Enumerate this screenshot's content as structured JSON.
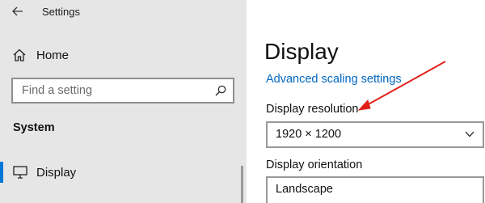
{
  "window": {
    "title": "Settings"
  },
  "sidebar": {
    "home_label": "Home",
    "search": {
      "placeholder": "Find a setting"
    },
    "section_title": "System",
    "items": [
      {
        "label": "Display",
        "selected": true
      }
    ]
  },
  "main": {
    "title": "Display",
    "advanced_link": "Advanced scaling settings",
    "resolution": {
      "label": "Display resolution",
      "value": "1920 × 1200"
    },
    "orientation": {
      "label": "Display orientation",
      "value": "Landscape"
    }
  },
  "colors": {
    "accent": "#0078d7",
    "link": "#0067c0",
    "annotation_arrow": "#e0201b",
    "sidebar_bg": "#e6e6e6"
  },
  "icons": [
    "back-arrow-icon",
    "home-icon",
    "search-icon",
    "monitor-icon",
    "chevron-down-icon"
  ]
}
